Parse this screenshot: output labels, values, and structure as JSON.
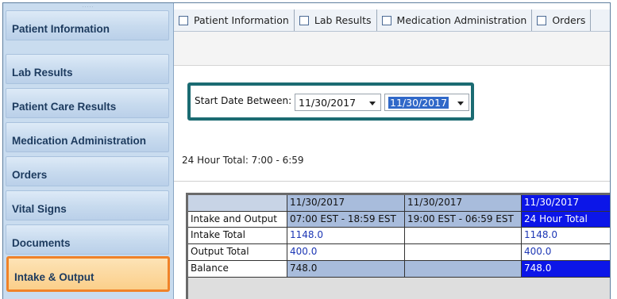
{
  "sidebar": {
    "grip": ".....",
    "items": [
      {
        "label": "Patient Information"
      },
      {
        "label": "Lab Results"
      },
      {
        "label": "Patient Care Results"
      },
      {
        "label": "Medication Administration"
      },
      {
        "label": "Orders"
      },
      {
        "label": "Vital Signs"
      },
      {
        "label": "Documents"
      },
      {
        "label": "Intake & Output",
        "active": true
      }
    ]
  },
  "tabs": [
    {
      "label": "Patient Information"
    },
    {
      "label": "Lab Results"
    },
    {
      "label": "Medication Administration"
    },
    {
      "label": "Orders"
    }
  ],
  "filter": {
    "label": "Start Date Between:",
    "start_date": "11/30/2017",
    "end_date": "11/30/2017"
  },
  "totals_text": "24 Hour Total:  7:00 - 6:59",
  "table": {
    "headers_date": [
      "11/30/2017",
      "11/30/2017",
      "11/30/2017"
    ],
    "headers_time": [
      "07:00 EST - 18:59 EST",
      "19:00 EST - 06:59 EST",
      "24 Hour Total"
    ],
    "row_header": "Intake and Output",
    "rows": [
      {
        "label": "Intake Total",
        "values": [
          "1148.0",
          "",
          "1148.0"
        ]
      },
      {
        "label": "Output Total",
        "values": [
          "400.0",
          "",
          "400.0"
        ]
      },
      {
        "label": "Balance",
        "values": [
          "748.0",
          "",
          "748.0"
        ]
      }
    ]
  },
  "colors": {
    "highlight_border": "#f08228",
    "datebox_border": "#1b6b72",
    "total_column": "#0c16e8"
  }
}
